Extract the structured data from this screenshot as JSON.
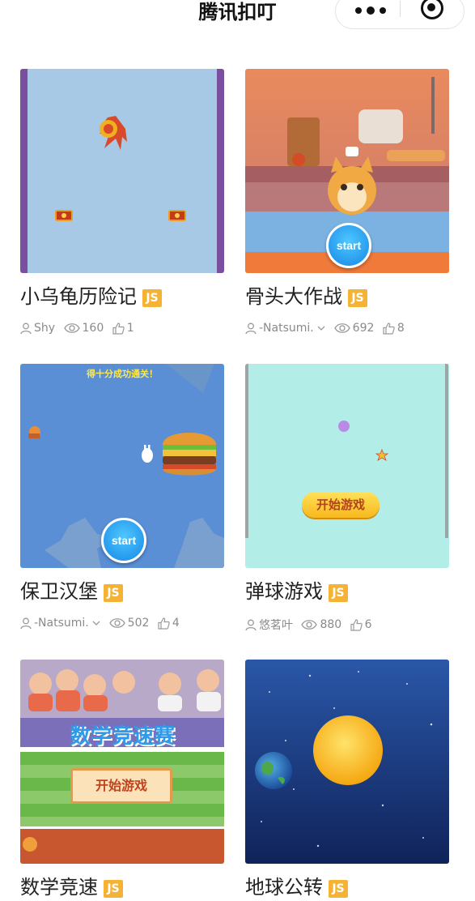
{
  "header": {
    "title": "腾讯扣叮"
  },
  "games": [
    {
      "name": "小乌龟历险记",
      "badge": "JS",
      "author": "Shy",
      "author_dropdown": false,
      "views": "160",
      "likes": "1"
    },
    {
      "name": "骨头大作战",
      "badge": "JS",
      "author": "-Natsumi.",
      "author_dropdown": true,
      "views": "692",
      "likes": "8"
    },
    {
      "name": "保卫汉堡",
      "badge": "JS",
      "author": "-Natsumi.",
      "author_dropdown": true,
      "views": "502",
      "likes": "4",
      "thumb_text": "得十分成功通关！"
    },
    {
      "name": "弹球游戏",
      "badge": "JS",
      "author": "悠茗叶",
      "author_dropdown": false,
      "views": "880",
      "likes": "6"
    },
    {
      "name": "数学竞速",
      "badge": "JS",
      "thumb_title": "数学竞速赛"
    },
    {
      "name": "地球公转",
      "badge": "JS"
    }
  ],
  "thumbs": {
    "start_label": "start",
    "start_game_label": "开始游戏"
  },
  "colors": {
    "badge": "#f5b335",
    "meta_text": "#8a8a8a",
    "start_blue": "#1587e6"
  },
  "icons": {
    "user": "person-outline-icon",
    "views": "eye-icon",
    "likes": "thumbs-up-icon"
  }
}
